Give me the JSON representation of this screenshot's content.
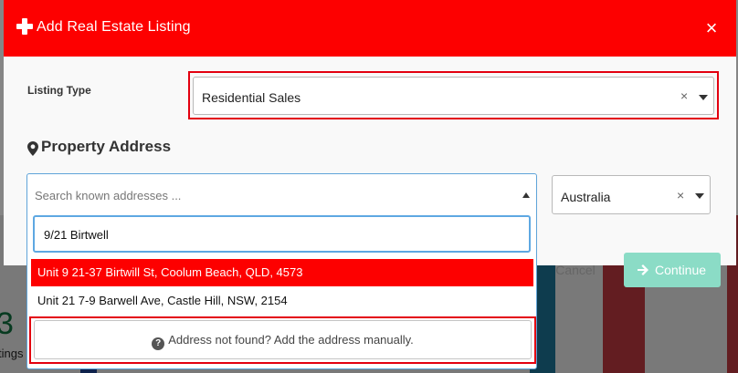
{
  "modal": {
    "title": "Add Real Estate Listing",
    "close_glyph": "×"
  },
  "listing_type": {
    "label": "Listing Type",
    "value": "Residential Sales",
    "clear_glyph": "×"
  },
  "property_address": {
    "title": "Property Address",
    "search_placeholder": "Search known addresses ...",
    "search_query": "9/21 Birtwell",
    "country": "Australia",
    "clear_glyph": "×",
    "results": [
      "Unit 9 21-37 Birtwill St, Coolum Beach, QLD, 4573",
      "Unit 21 7-9 Barwell Ave, Castle Hill, NSW, 2154"
    ],
    "manual_entry_label": "Address not found? Add the address manually."
  },
  "footer": {
    "cancel_label": "Cancel",
    "continue_label": "Continue"
  },
  "background": {
    "stat_value": "3",
    "stat_label": "tings"
  },
  "colors": {
    "header": "#fd0000",
    "highlight_border": "#e3000f",
    "active_option": "#fd0000",
    "continue_button": "#8bdcc6",
    "focus_border": "#5ea8e2"
  },
  "icons": {
    "header": "plus-icon",
    "close": "close-icon",
    "section": "map-marker-icon",
    "continue": "arrow-right-icon",
    "manual": "question-circle-icon"
  }
}
